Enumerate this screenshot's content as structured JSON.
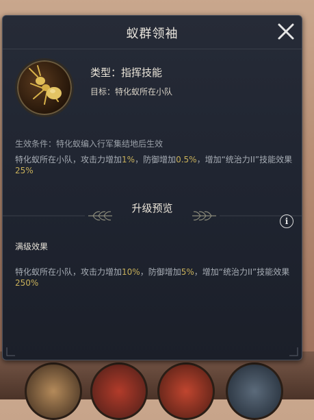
{
  "dialog": {
    "title": "蚁群领袖",
    "skill_type": "类型：指挥技能",
    "skill_target": "目标：特化蚁所在小队",
    "condition": "生效条件：特化蚁编入行军集结地后生效",
    "desc": {
      "p1": "特化蚁所在小队，攻击力增加",
      "v1": "1%",
      "p2": "，防御增加",
      "v2": "0.5%",
      "p3": "，增加“统治力II”技能效果",
      "v3": "25%"
    },
    "upgrade_title": "升级预览",
    "info_label": "i",
    "max_title": "满级效果",
    "max_desc": {
      "p1": "特化蚁所在小队，攻击力增加",
      "v1": "10%",
      "p2": "，防御增加",
      "v2": "5%",
      "p3": "，增加“统治力II”技能效果",
      "v3": "250%"
    }
  },
  "icons": {
    "close": "close-icon",
    "skill": "ant-icon",
    "info": "info-icon",
    "wheat_left": "wheat-ornament-icon",
    "wheat_right": "wheat-ornament-icon"
  },
  "colors": {
    "panel_bg": "#1f2430",
    "highlight": "#c9b15a",
    "text": "#a7adb5",
    "title": "#e8e4dc"
  }
}
